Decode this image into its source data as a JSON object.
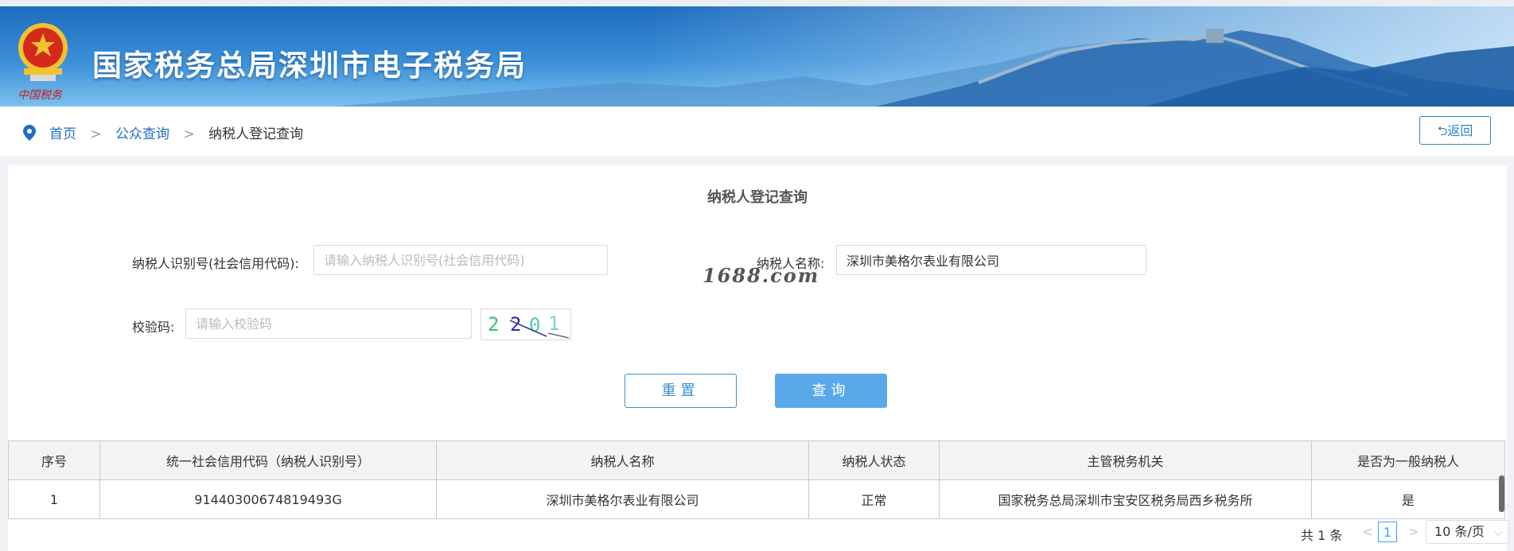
{
  "banner": {
    "title": "国家税务总局深圳市电子税务局",
    "emblem_caption": "中国税务"
  },
  "breadcrumb": {
    "home": "首页",
    "separator": ">",
    "public_query": "公众查询",
    "current": "纳税人登记查询"
  },
  "back_button": {
    "icon": "return-icon",
    "label": "返回"
  },
  "form": {
    "title": "纳税人登记查询",
    "taxpayer_id_label": "纳税人识别号(社会信用代码):",
    "taxpayer_id_placeholder": "请输入纳税人识别号(社会信用代码)",
    "taxpayer_id_value": "",
    "taxpayer_name_label": "纳税人名称:",
    "taxpayer_name_value": "深圳市美格尔表业有限公司",
    "captcha_label": "校验码:",
    "captcha_placeholder": "请输入校验码",
    "captcha_value": "",
    "captcha_image_text": "2201",
    "reset_label": "重置",
    "query_label": "查询"
  },
  "watermark": "1688.com",
  "table": {
    "headers": [
      "序号",
      "统一社会信用代码（纳税人识别号）",
      "纳税人名称",
      "纳税人状态",
      "主管税务机关",
      "是否为一般纳税人"
    ],
    "rows": [
      [
        "1",
        "91440300674819493G",
        "深圳市美格尔表业有限公司",
        "正常",
        "国家税务总局深圳市宝安区税务局西乡税务所",
        "是"
      ]
    ]
  },
  "pagination": {
    "total": "共 1 条",
    "prev": "<",
    "current_page": "1",
    "next": ">",
    "page_size": "10 条/页"
  },
  "colors": {
    "accent": "#2b84c9",
    "query_button": "#5aa8ea",
    "link": "#1f6fbf"
  }
}
